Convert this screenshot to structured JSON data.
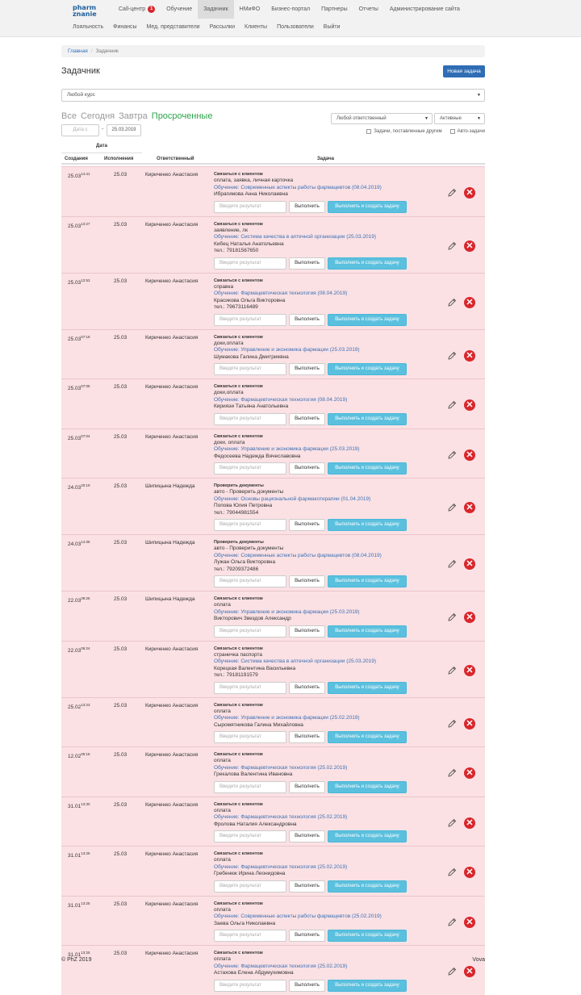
{
  "colors": {
    "accent": "#2f6db5",
    "overdue_row": "#fbe1e4",
    "success_btn": "#5bc0de",
    "active_filter": "#2ca24a",
    "delete": "#d9262c"
  },
  "logo": {
    "line1": "pharm",
    "line2": "znanie"
  },
  "nav_top": [
    {
      "label": "Call-центр",
      "badge": "1"
    },
    {
      "label": "Обучение"
    },
    {
      "label": "Задачник",
      "active": true
    },
    {
      "label": "НМиФО"
    },
    {
      "label": "Бизнес-портал"
    },
    {
      "label": "Партнеры"
    },
    {
      "label": "Отчеты"
    },
    {
      "label": "Администрирование сайта"
    }
  ],
  "nav_sub": [
    "Лояльность",
    "Финансы",
    "Мед. представители",
    "Рассылки",
    "Клиенты",
    "Пользователи",
    "Выйти"
  ],
  "breadcrumb": {
    "home": "Главная",
    "current": "Задачник"
  },
  "page_title": "Задачник",
  "new_task_button": "Новая задача",
  "course_select": "Любой курс",
  "filters": [
    "Все",
    "Сегодня",
    "Завтра",
    "Просроченные"
  ],
  "active_filter": "Просроченные",
  "responsible_select": "Любой ответственный",
  "status_select": "Активные",
  "checkbox_others": "Задачи, поставленные другим",
  "checkbox_auto": "Авто-задачи",
  "date_from_placeholder": "Дата с",
  "date_to_value": "25.03.2019",
  "table_headers": {
    "date_group": "Дата",
    "created": "Создания",
    "executed": "Исполнения",
    "responsible": "Ответственный",
    "task": "Задача"
  },
  "result_placeholder": "Введите результат",
  "btn_done": "Выполнить",
  "btn_done_create": "Выполнить и создать задачу",
  "rows": [
    {
      "created": "25.03",
      "time": "14:41",
      "exec": "25.03",
      "resp": "Кириченко Анастасия",
      "type": "Связаться с клиентом",
      "note": "оплата, заявка, личная карточка",
      "course": "Обучение: Современные аспекты работы фармацевтов (08.04.2019)",
      "client": "Ибрагимова Анна Николаевна",
      "phone": ""
    },
    {
      "created": "25.03",
      "time": "13:27",
      "exec": "25.03",
      "resp": "Кириченко Анастасия",
      "type": "Связаться с клиентом",
      "note": "заявление, лк",
      "course": "Обучение: Система качества в аптечной организации (25.03.2019)",
      "client": "Кибец Наталья Анатольевна",
      "phone": "тел.: 79181567650"
    },
    {
      "created": "25.03",
      "time": "12:53",
      "exec": "25.03",
      "resp": "Кириченко Анастасия",
      "type": "Связаться с клиентом",
      "note": "справка",
      "course": "Обучение: Фармацевтическая технология (08.04.2019)",
      "client": "Красикова Ольга Викторовна",
      "phone": "тел.: 79673116489"
    },
    {
      "created": "25.03",
      "time": "07:18",
      "exec": "25.03",
      "resp": "Кириченко Анастасия",
      "type": "Связаться с клиентом",
      "note": "доки,оплата",
      "course": "Обучение: Управление и экономика фармации (25.03.2019)",
      "client": "Шумакова Галина Дмитриевна",
      "phone": ""
    },
    {
      "created": "25.03",
      "time": "07:05",
      "exec": "25.03",
      "resp": "Кириченко Анастасия",
      "type": "Связаться с клиентом",
      "note": "доки,оплата",
      "course": "Обучение: Фармацевтическая технология (08.04.2019)",
      "client": "Кирияэи Татьяна Анатольевна",
      "phone": ""
    },
    {
      "created": "25.03",
      "time": "07:04",
      "exec": "25.03",
      "resp": "Кириченко Анастасия",
      "type": "Связаться с клиентом",
      "note": "доки, оплата",
      "course": "Обучение: Управление и экономика фармации (25.03.2019)",
      "client": "Федосеева Надежда Вячеславовна",
      "phone": ""
    },
    {
      "created": "24.03",
      "time": "20:19",
      "exec": "25.03",
      "resp": "Шипицына Надежда",
      "type": "Проверить документы",
      "note": "авто - Проверить документы",
      "course": "Обучение: Основы рациональной фармакотерапии (01.04.2019)",
      "client": "Попова Юлия Петровна",
      "phone": "тел.: 79044981554"
    },
    {
      "created": "24.03",
      "time": "14:36",
      "exec": "25.03",
      "resp": "Шипицына Надежда",
      "type": "Проверить документы",
      "note": "авто - Проверить документы",
      "course": "Обучение: Современные аспекты работы фармацевтов (08.04.2019)",
      "client": "Лужан Ольга Викторовна",
      "phone": "тел.: 79209372486"
    },
    {
      "created": "22.03",
      "time": "09:26",
      "exec": "25.03",
      "resp": "Шипицына Надежда",
      "type": "Связаться с клиентом",
      "note": "оплата",
      "course": "Обучение: Управление и экономика фармации (25.03.2019)",
      "client": "Викторович Звездов Александр",
      "phone": ""
    },
    {
      "created": "22.03",
      "time": "06:24",
      "exec": "25.03",
      "resp": "Кириченко Анастасия",
      "type": "Связаться с клиентом",
      "note": "страничка паспорта",
      "course": "Обучение: Система качества в аптечной организации (25.03.2019)",
      "client": "Корецкая Валентина Васильевна",
      "phone": "тел.: 79181191579"
    },
    {
      "created": "25.02",
      "time": "13:23",
      "exec": "25.03",
      "resp": "Кириченко Анастасия",
      "type": "Связаться с клиентом",
      "note": "оплата",
      "course": "Обучение: Управление и экономика фармации (25.02.2019)",
      "client": "Сыромятникова Галина Михайловна",
      "phone": ""
    },
    {
      "created": "12.02",
      "time": "05:16",
      "exec": "25.03",
      "resp": "Кириченко Анастасия",
      "type": "Связаться с клиентом",
      "note": "оплата",
      "course": "Обучение: Фармацевтическая технология (25.02.2019)",
      "client": "Грекалова Валентина Ивановна",
      "phone": ""
    },
    {
      "created": "31.01",
      "time": "13:30",
      "exec": "25.03",
      "resp": "Кириченко Анастасия",
      "type": "Связаться с клиентом",
      "note": "оплата",
      "course": "Обучение: Фармацевтическая технология (25.02.2019)",
      "client": "Фролова Наталия Александровна",
      "phone": ""
    },
    {
      "created": "31.01",
      "time": "13:26",
      "exec": "25.03",
      "resp": "Кириченко Анастасия",
      "type": "Связаться с клиентом",
      "note": "оплата",
      "course": "Обучение: Фармацевтическая технология (25.02.2019)",
      "client": "Гребенюк Ирина Леонидовна",
      "phone": ""
    },
    {
      "created": "31.01",
      "time": "13:25",
      "exec": "25.03",
      "resp": "Кириченко Анастасия",
      "type": "Связаться с клиентом",
      "note": "оплата",
      "course": "Обучение: Современные аспекты работы фармацевтов (25.02.2019)",
      "client": "Заева Ольга Николаевна",
      "phone": ""
    },
    {
      "created": "31.01",
      "time": "13:25",
      "exec": "25.03",
      "resp": "Кириченко Анастасия",
      "type": "Связаться с клиентом",
      "note": "оплата",
      "course": "Обучение: Фармацевтическая технология (25.02.2019)",
      "client": "Астахова Елена Абдумухимовна",
      "phone": ""
    }
  ],
  "footer": {
    "left": "© PhZ 2019",
    "right": "Vova"
  }
}
